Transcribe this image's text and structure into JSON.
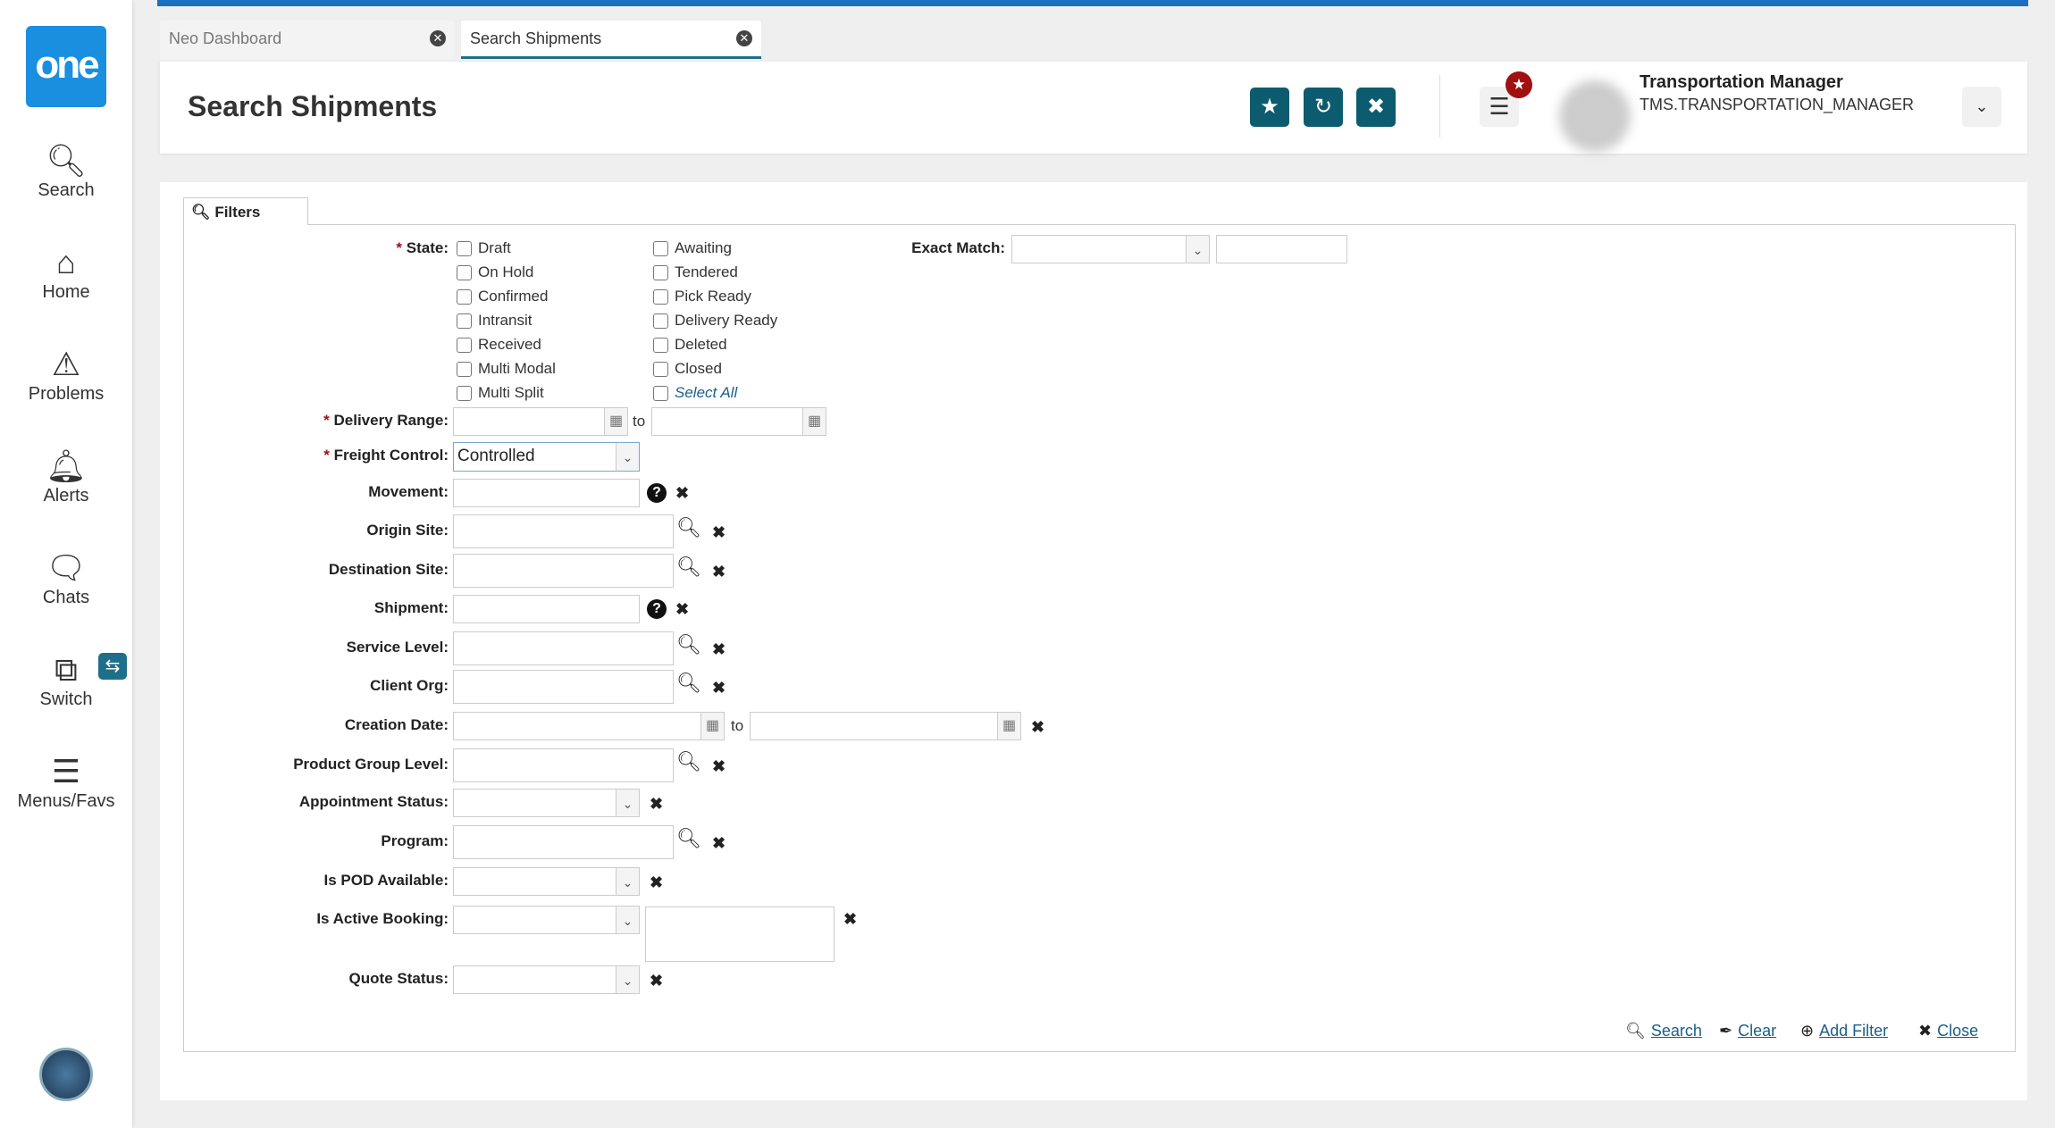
{
  "colors": {
    "accent": "#0d5b6e",
    "brand": "#1a8fe0",
    "top_bar": "#1a6fc0",
    "badge": "#a01010"
  },
  "sidebar": {
    "logo": "one",
    "items": [
      {
        "label": "Search",
        "icon": "search-icon"
      },
      {
        "label": "Home",
        "icon": "home-icon"
      },
      {
        "label": "Problems",
        "icon": "warning-icon"
      },
      {
        "label": "Alerts",
        "icon": "bell-icon"
      },
      {
        "label": "Chats",
        "icon": "chat-icon"
      },
      {
        "label": "Switch",
        "icon": "switch-icon"
      },
      {
        "label": "Menus/Favs",
        "icon": "menu-icon"
      }
    ]
  },
  "tabs": [
    {
      "label": "Neo Dashboard"
    },
    {
      "label": "Search Shipments"
    }
  ],
  "header": {
    "title": "Search Shipments",
    "user_name": "Transportation Manager",
    "user_role": "TMS.TRANSPORTATION_MANAGER"
  },
  "filters": {
    "tab_label": "Filters",
    "state_label": "State:",
    "states_col1": [
      "Draft",
      "On Hold",
      "Confirmed",
      "Intransit",
      "Received",
      "Multi Modal",
      "Multi Split"
    ],
    "states_col2": [
      "Awaiting",
      "Tendered",
      "Pick Ready",
      "Delivery Ready",
      "Deleted",
      "Closed",
      "Select All"
    ],
    "exact_match_label": "Exact Match:",
    "delivery_range_label": "Delivery Range:",
    "to": "to",
    "freight_control_label": "Freight Control:",
    "freight_control_value": "Controlled",
    "movement_label": "Movement:",
    "origin_site_label": "Origin Site:",
    "destination_site_label": "Destination Site:",
    "shipment_label": "Shipment:",
    "service_level_label": "Service Level:",
    "client_org_label": "Client Org:",
    "creation_date_label": "Creation Date:",
    "product_group_level_label": "Product Group Level:",
    "appointment_status_label": "Appointment Status:",
    "program_label": "Program:",
    "is_pod_available_label": "Is POD Available:",
    "is_active_booking_label": "Is Active Booking:",
    "quote_status_label": "Quote Status:"
  },
  "actions": {
    "search": "Search",
    "clear": "Clear",
    "add_filter": "Add Filter",
    "close": "Close"
  }
}
